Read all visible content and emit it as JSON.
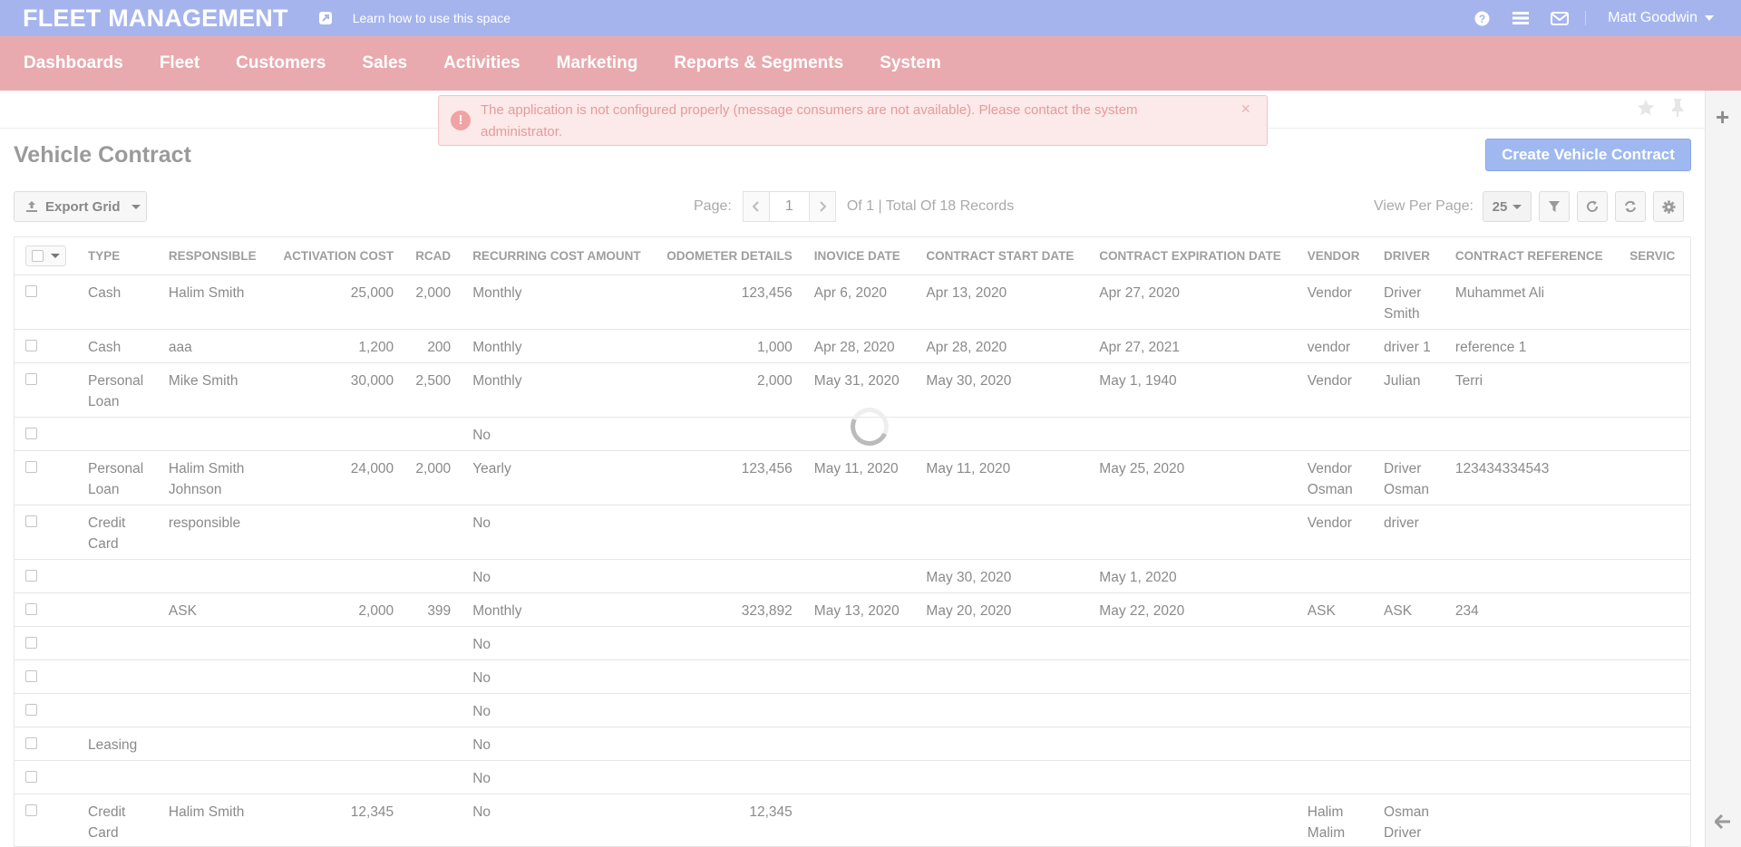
{
  "header": {
    "brand": "FLEET MANAGEMENT",
    "learn_link": "Learn how to use this space",
    "user": "Matt Goodwin"
  },
  "nav": [
    "Dashboards",
    "Fleet",
    "Customers",
    "Sales",
    "Activities",
    "Marketing",
    "Reports & Segments",
    "System"
  ],
  "alert": {
    "message": "The application is not configured properly (message consumers are not available). Please contact the system administrator.",
    "close": "×"
  },
  "page": {
    "title": "Vehicle Contract",
    "create_button": "Create Vehicle Contract"
  },
  "toolbar": {
    "export": "Export Grid",
    "page_label": "Page:",
    "page_value": "1",
    "page_total": "Of 1 | Total Of 18 Records",
    "view_per_page": "View Per Page:",
    "per_page_value": "25"
  },
  "grid": {
    "columns": [
      "TYPE",
      "RESPONSIBLE",
      "ACTIVATION COST",
      "RCAD",
      "RECURRING COST AMOUNT",
      "ODOMETER DETAILS",
      "INOVICE DATE",
      "CONTRACT START DATE",
      "CONTRACT EXPIRATION DATE",
      "VENDOR",
      "DRIVER",
      "CONTRACT REFERENCE",
      "SERVIC"
    ],
    "rows": [
      [
        "Cash",
        "Halim Smith",
        "25,000",
        "2,000",
        "Monthly",
        "123,456",
        "Apr 6, 2020",
        "Apr 13, 2020",
        "Apr 27, 2020",
        "Vendor",
        "Driver Smith",
        "Muhammet Ali",
        ""
      ],
      [
        "Cash",
        "aaa",
        "1,200",
        "200",
        "Monthly",
        "1,000",
        "Apr 28, 2020",
        "Apr 28, 2020",
        "Apr 27, 2021",
        "vendor",
        "driver 1",
        "reference 1",
        ""
      ],
      [
        "Personal Loan",
        "Mike Smith",
        "30,000",
        "2,500",
        "Monthly",
        "2,000",
        "May 31, 2020",
        "May 30, 2020",
        "May 1, 1940",
        "Vendor",
        "Julian",
        "Terri",
        ""
      ],
      [
        "",
        "",
        "",
        "",
        "No",
        "",
        "",
        "",
        "",
        "",
        "",
        "",
        ""
      ],
      [
        "Personal Loan",
        "Halim Smith Johnson",
        "24,000",
        "2,000",
        "Yearly",
        "123,456",
        "May 11, 2020",
        "May 11, 2020",
        "May 25, 2020",
        "Vendor Osman",
        "Driver Osman",
        "123434334543",
        ""
      ],
      [
        "Credit Card",
        "responsible",
        "",
        "",
        "No",
        "",
        "",
        "",
        "",
        "Vendor",
        "driver",
        "",
        ""
      ],
      [
        "",
        "",
        "",
        "",
        "No",
        "",
        "",
        "May 30, 2020",
        "May 1, 2020",
        "",
        "",
        "",
        ""
      ],
      [
        "",
        "ASK",
        "2,000",
        "399",
        "Monthly",
        "323,892",
        "May 13, 2020",
        "May 20, 2020",
        "May 22, 2020",
        "ASK",
        "ASK",
        "234",
        ""
      ],
      [
        "",
        "",
        "",
        "",
        "No",
        "",
        "",
        "",
        "",
        "",
        "",
        "",
        ""
      ],
      [
        "",
        "",
        "",
        "",
        "No",
        "",
        "",
        "",
        "",
        "",
        "",
        "",
        ""
      ],
      [
        "",
        "",
        "",
        "",
        "No",
        "",
        "",
        "",
        "",
        "",
        "",
        "",
        ""
      ],
      [
        "Leasing",
        "",
        "",
        "",
        "No",
        "",
        "",
        "",
        "",
        "",
        "",
        "",
        ""
      ],
      [
        "",
        "",
        "",
        "",
        "No",
        "",
        "",
        "",
        "",
        "",
        "",
        "",
        ""
      ],
      [
        "Credit Card",
        "Halim Smith",
        "12,345",
        "",
        "No",
        "12,345",
        "",
        "",
        "",
        "Halim Malim",
        "Osman Driver",
        "",
        ""
      ]
    ]
  },
  "icons": {
    "learn": "external-link-icon",
    "help": "question-circle-icon",
    "tasks": "list-icon",
    "email": "envelope-icon",
    "star": "star-icon",
    "pin": "pin-icon",
    "add": "plus-icon",
    "collapse": "arrow-left-icon",
    "filter": "filter-icon",
    "refresh": "refresh-icon",
    "reset": "sync-icon",
    "settings": "gear-icon"
  }
}
